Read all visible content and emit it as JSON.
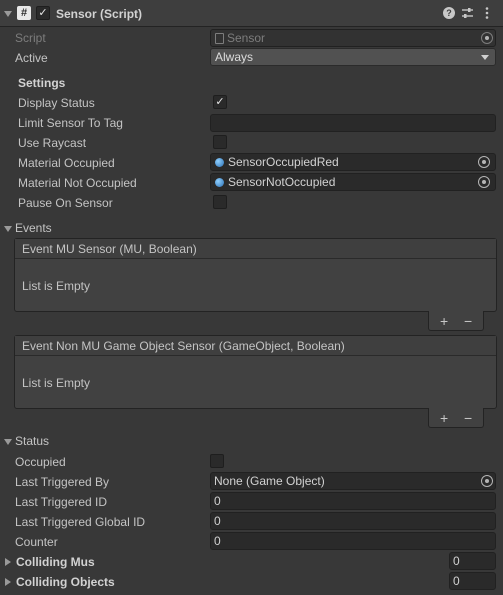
{
  "component": {
    "title": "Sensor (Script)",
    "script_label": "Script",
    "script_value": "Sensor",
    "active_label": "Active",
    "active_value": "Always"
  },
  "settings": {
    "heading": "Settings",
    "display_status": "Display Status",
    "limit_sensor_to_tag": "Limit Sensor To Tag",
    "use_raycast": "Use Raycast",
    "material_occupied": "Material Occupied",
    "material_occupied_value": "SensorOccupiedRed",
    "material_not_occupied": "Material Not Occupied",
    "material_not_occupied_value": "SensorNotOccupied",
    "pause_on_sensor": "Pause On Sensor"
  },
  "events": {
    "heading": "Events",
    "event_mu": {
      "title": "Event MU Sensor (MU, Boolean)",
      "empty": "List is Empty"
    },
    "event_non_mu": {
      "title": "Event Non MU Game Object Sensor (GameObject, Boolean)",
      "empty": "List is Empty"
    },
    "add_glyph": "+",
    "remove_glyph": "−"
  },
  "status": {
    "heading": "Status",
    "occupied": "Occupied",
    "last_triggered_by": "Last Triggered By",
    "last_triggered_by_value": "None (Game Object)",
    "last_triggered_id": "Last Triggered ID",
    "last_triggered_id_value": "0",
    "last_triggered_global_id": "Last Triggered Global ID",
    "last_triggered_global_id_value": "0",
    "counter": "Counter",
    "counter_value": "0"
  },
  "colliding": {
    "mus": "Colliding Mus",
    "mus_count": "0",
    "objects": "Colliding Objects",
    "objects_count": "0"
  },
  "checks": {
    "enabled": true,
    "display_status": true,
    "use_raycast": false,
    "pause_on_sensor": false,
    "occupied": false
  }
}
